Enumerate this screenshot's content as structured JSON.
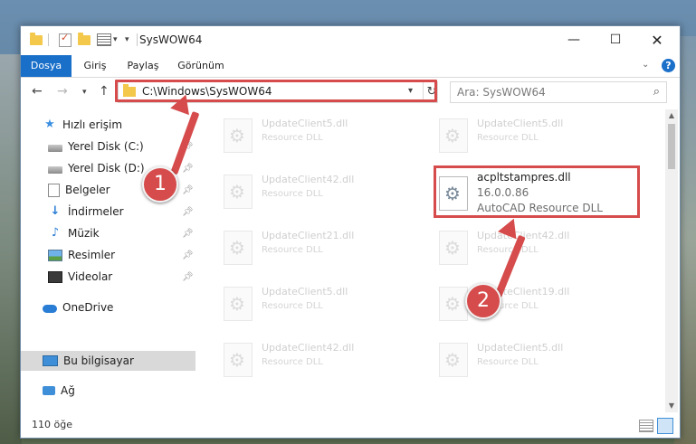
{
  "window": {
    "title": "SysWOW64"
  },
  "ribbon": {
    "tabs": [
      "Dosya",
      "Giriş",
      "Paylaş",
      "Görünüm"
    ]
  },
  "address": {
    "path": "C:\\Windows\\SysWOW64"
  },
  "search": {
    "placeholder": "Ara: SysWOW64"
  },
  "nav": {
    "quick_access": "Hızlı erişim",
    "items": [
      "Yerel Disk (C:)",
      "Yerel Disk (D:)",
      "Belgeler",
      "İndirmeler",
      "Müzik",
      "Resimler",
      "Videolar"
    ],
    "onedrive": "OneDrive",
    "this_pc": "Bu bilgisayar",
    "network": "Ağ"
  },
  "files": {
    "left": [
      {
        "name": "UpdateClient5.dll",
        "type": "Resource DLL"
      },
      {
        "name": "UpdateClient42.dll",
        "type": "Resource DLL"
      },
      {
        "name": "UpdateClient21.dll",
        "type": "Resource DLL"
      },
      {
        "name": "UpdateClient5.dll",
        "type": "Resource DLL"
      },
      {
        "name": "UpdateClient42.dll",
        "type": "Resource DLL"
      }
    ],
    "right": [
      {
        "name": "UpdateClient5.dll",
        "type": "Resource DLL"
      },
      {
        "name": "UpdateClient42.dll",
        "type": "Resource DLL"
      },
      {
        "name": "UpdateClient19.dll",
        "type": "Resource DLL"
      },
      {
        "name": "UpdateClient5.dll",
        "type": "Resource DLL"
      }
    ],
    "highlighted": {
      "name": "acpltstampres.dll",
      "version": "16.0.0.86",
      "type": "AutoCAD Resource DLL"
    }
  },
  "status": {
    "count": "110 öğe"
  },
  "annotations": {
    "badge1": "1",
    "badge2": "2"
  },
  "colors": {
    "accent": "#1a6fc9",
    "annotation": "#d64b4b"
  }
}
